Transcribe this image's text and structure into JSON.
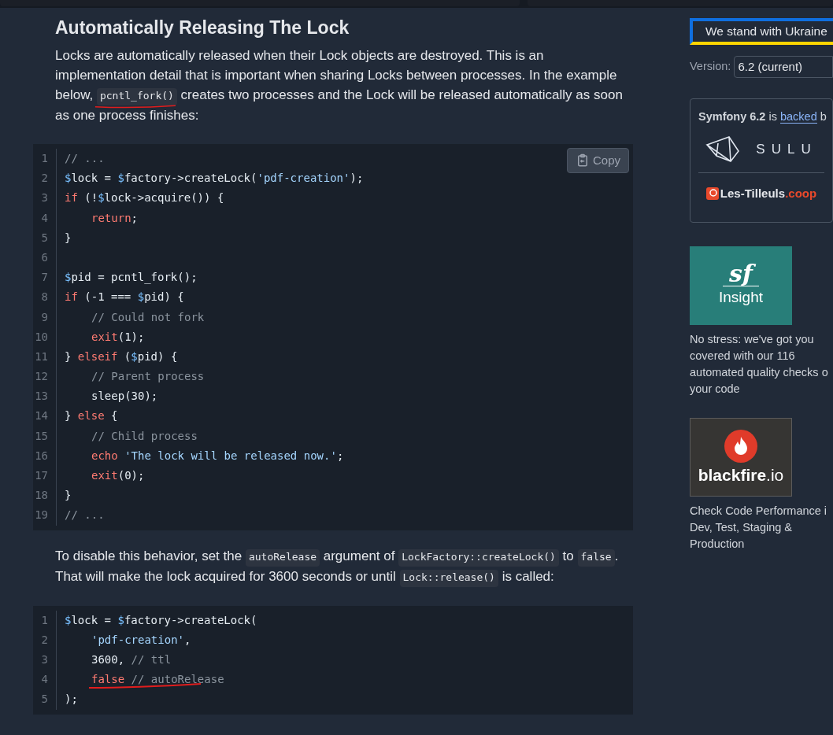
{
  "article": {
    "heading": "Automatically Releasing The Lock",
    "intro": [
      {
        "kind": "text",
        "text": "Locks are automatically released when their Lock objects are destroyed. This is an implementation detail that is important when sharing Locks between processes. In the example below, "
      },
      {
        "kind": "code",
        "text": "pcntl_fork()",
        "underlined": true
      },
      {
        "kind": "text",
        "text": " creates two processes and the Lock will be released automatically as soon as one process finishes:"
      }
    ],
    "code_1": {
      "copy_button": "Copy",
      "lines": [
        {
          "number": "1",
          "indented": false,
          "tokens": [
            {
              "kind": "comment",
              "text": "// ..."
            }
          ]
        },
        {
          "number": "2",
          "indented": false,
          "tokens": [
            {
              "kind": "var",
              "text": "$"
            },
            {
              "kind": "plain",
              "text": "lock = "
            },
            {
              "kind": "var",
              "text": "$"
            },
            {
              "kind": "plain",
              "text": "factory->createLock("
            },
            {
              "kind": "str",
              "text": "'pdf-creation'"
            },
            {
              "kind": "plain",
              "text": ");"
            }
          ]
        },
        {
          "number": "3",
          "indented": false,
          "tokens": [
            {
              "kind": "kw",
              "text": "if"
            },
            {
              "kind": "plain",
              "text": " (!"
            },
            {
              "kind": "var",
              "text": "$"
            },
            {
              "kind": "plain",
              "text": "lock->acquire()) {"
            }
          ]
        },
        {
          "number": "4",
          "indented": true,
          "tokens": [
            {
              "kind": "kw",
              "text": "return"
            },
            {
              "kind": "plain",
              "text": ";"
            }
          ]
        },
        {
          "number": "5",
          "indented": false,
          "tokens": [
            {
              "kind": "plain",
              "text": "}"
            }
          ]
        },
        {
          "number": "6",
          "indented": false
        },
        {
          "number": "7",
          "indented": false,
          "tokens": [
            {
              "kind": "var",
              "text": "$"
            },
            {
              "kind": "plain",
              "text": "pid = pcntl_fork();"
            }
          ]
        },
        {
          "number": "8",
          "indented": false,
          "tokens": [
            {
              "kind": "kw",
              "text": "if"
            },
            {
              "kind": "plain",
              "text": " (-1 === "
            },
            {
              "kind": "var",
              "text": "$"
            },
            {
              "kind": "plain",
              "text": "pid) {"
            }
          ]
        },
        {
          "number": "9",
          "indented": true,
          "tokens": [
            {
              "kind": "comment",
              "text": "// Could not fork"
            }
          ]
        },
        {
          "number": "10",
          "indented": true,
          "tokens": [
            {
              "kind": "kw",
              "text": "exit"
            },
            {
              "kind": "plain",
              "text": "(1);"
            }
          ]
        },
        {
          "number": "11",
          "indented": false,
          "tokens": [
            {
              "kind": "plain",
              "text": "} "
            },
            {
              "kind": "kw",
              "text": "elseif"
            },
            {
              "kind": "plain",
              "text": " ("
            },
            {
              "kind": "var",
              "text": "$"
            },
            {
              "kind": "plain",
              "text": "pid) {"
            }
          ]
        },
        {
          "number": "12",
          "indented": true,
          "tokens": [
            {
              "kind": "comment",
              "text": "// Parent process"
            }
          ]
        },
        {
          "number": "13",
          "indented": true,
          "tokens": [
            {
              "kind": "plain",
              "text": "sleep(30);"
            }
          ]
        },
        {
          "number": "14",
          "indented": false,
          "tokens": [
            {
              "kind": "plain",
              "text": "} "
            },
            {
              "kind": "kw",
              "text": "else"
            },
            {
              "kind": "plain",
              "text": " {"
            }
          ]
        },
        {
          "number": "15",
          "indented": true,
          "tokens": [
            {
              "kind": "comment",
              "text": "// Child process"
            }
          ]
        },
        {
          "number": "16",
          "indented": true,
          "tokens": [
            {
              "kind": "kw",
              "text": "echo "
            },
            {
              "kind": "str",
              "text": "'The lock will be released now.'"
            },
            {
              "kind": "plain",
              "text": ";"
            }
          ]
        },
        {
          "number": "17",
          "indented": true,
          "tokens": [
            {
              "kind": "kw",
              "text": "exit"
            },
            {
              "kind": "plain",
              "text": "(0);"
            }
          ]
        },
        {
          "number": "18",
          "indented": false,
          "tokens": [
            {
              "kind": "plain",
              "text": "}"
            }
          ]
        },
        {
          "number": "19",
          "indented": false,
          "tokens": [
            {
              "kind": "comment",
              "text": "// ..."
            }
          ]
        }
      ]
    },
    "para_2": [
      {
        "kind": "text",
        "text": "To disable this behavior, set the "
      },
      {
        "kind": "code",
        "text": "autoRelease",
        "underlined": false
      },
      {
        "kind": "text",
        "text": " argument of "
      },
      {
        "kind": "code",
        "text": "LockFactory::createLock()",
        "underlined": false
      },
      {
        "kind": "text",
        "text": " to "
      },
      {
        "kind": "code",
        "text": "false",
        "underlined": false
      },
      {
        "kind": "text",
        "text": ". That will make the lock acquired for 3600 seconds or until "
      },
      {
        "kind": "code",
        "text": "Lock::release()",
        "underlined": false
      },
      {
        "kind": "text",
        "text": " is called:"
      }
    ],
    "code_2": {
      "lines": [
        {
          "number": "1",
          "indented": false,
          "underlined": false,
          "tokens": [
            {
              "kind": "var",
              "text": "$"
            },
            {
              "kind": "plain",
              "text": "lock = "
            },
            {
              "kind": "var",
              "text": "$"
            },
            {
              "kind": "plain",
              "text": "factory->createLock("
            }
          ]
        },
        {
          "number": "2",
          "indented": true,
          "underlined": false,
          "tokens": [
            {
              "kind": "str",
              "text": "'pdf-creation'"
            },
            {
              "kind": "plain",
              "text": ","
            }
          ]
        },
        {
          "number": "3",
          "indented": true,
          "underlined": false,
          "tokens": [
            {
              "kind": "plain",
              "text": "3600, "
            },
            {
              "kind": "comment",
              "text": "// ttl"
            }
          ]
        },
        {
          "number": "4",
          "indented": true,
          "underlined": true,
          "tokens": [
            {
              "kind": "kw",
              "text": "false"
            },
            {
              "kind": "comment",
              "text": " // autoRelease"
            }
          ]
        },
        {
          "number": "5",
          "indented": false,
          "underlined": false,
          "tokens": [
            {
              "kind": "plain",
              "text": ");"
            }
          ]
        }
      ]
    }
  },
  "sidebar": {
    "banner": "We stand with Ukraine",
    "version_label": "Version:",
    "version_value": "6.2 (current)",
    "backers": {
      "product": "Symfony 6.2",
      "text": " is ",
      "link": "backed",
      "tail": " b",
      "sponsors": [
        "SULU",
        "Les-Tilleuls",
        ".coop"
      ]
    },
    "ads": [
      {
        "kind": "insight",
        "logo_mark": "sf",
        "logo_text": "Insight",
        "caption": "No stress: we've got you covered with our 116 automated quality checks o your code"
      },
      {
        "kind": "blackfire",
        "logo_text": "blackfire",
        "logo_suffix": ".io",
        "caption": "Check Code Performance i Dev, Test, Staging & Production"
      }
    ]
  }
}
